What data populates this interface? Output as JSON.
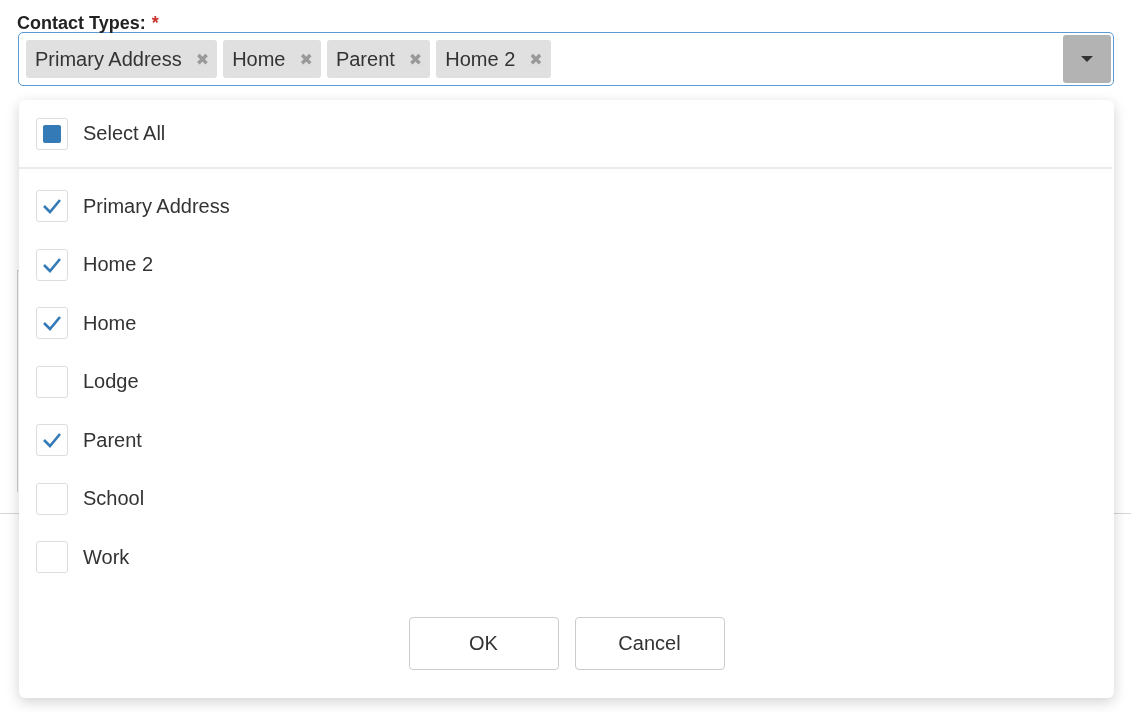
{
  "field": {
    "label": "Contact Types:",
    "required_mark": "*",
    "tags": [
      {
        "label": "Primary Address",
        "remove": "✖"
      },
      {
        "label": "Home",
        "remove": "✖"
      },
      {
        "label": "Parent",
        "remove": "✖"
      },
      {
        "label": "Home 2",
        "remove": "✖"
      }
    ]
  },
  "dropdown": {
    "select_all": {
      "label": "Select All",
      "checked": false,
      "indeterminate": true
    },
    "options": [
      {
        "label": "Primary Address",
        "checked": true
      },
      {
        "label": "Home 2",
        "checked": true
      },
      {
        "label": "Home",
        "checked": true
      },
      {
        "label": "Lodge",
        "checked": false
      },
      {
        "label": "Parent",
        "checked": true
      },
      {
        "label": "School",
        "checked": false
      },
      {
        "label": "Work",
        "checked": false
      }
    ],
    "buttons": [
      "OK",
      "Cancel"
    ]
  }
}
